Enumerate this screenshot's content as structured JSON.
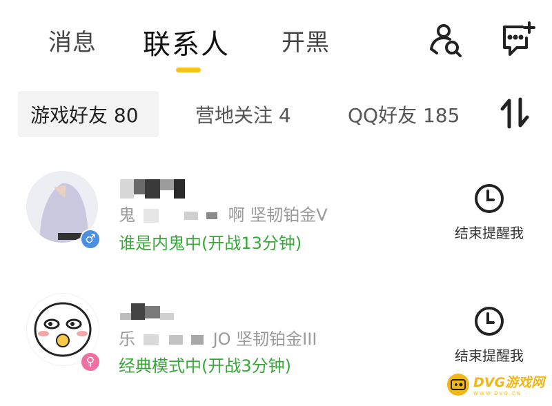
{
  "top_tabs": [
    {
      "label": "消息",
      "active": false
    },
    {
      "label": "联系人",
      "active": true
    },
    {
      "label": "开黑",
      "active": false
    }
  ],
  "header_icons": [
    "find-person-icon",
    "new-chat-icon"
  ],
  "sub_tabs": [
    {
      "label": "游戏好友 80",
      "active": true
    },
    {
      "label": "营地关注 4",
      "active": false
    },
    {
      "label": "QQ好友 185",
      "active": false
    }
  ],
  "sort_icon": "sort-icon",
  "contacts": [
    {
      "rank_visible": "啊  坚韧铂金V",
      "rank_prefix": "鬼",
      "status": "谁是内鬼中(开战13分钟)",
      "gender": "male",
      "gender_symbol": "♂",
      "remind_label": "结束提醒我"
    },
    {
      "rank_visible": "JO  坚韧铂金III",
      "rank_prefix": "乐",
      "status": "经典模式中(开战3分钟)",
      "gender": "female",
      "gender_symbol": "♀",
      "remind_label": "结束提醒我"
    }
  ],
  "colors": {
    "accent": "#f7c21b",
    "status_green": "#3aa53a",
    "male": "#4a8fe0",
    "female": "#ee6fa2"
  },
  "watermark": {
    "title": "DVG游戏网",
    "sub": "WWW.DVG.CN"
  }
}
